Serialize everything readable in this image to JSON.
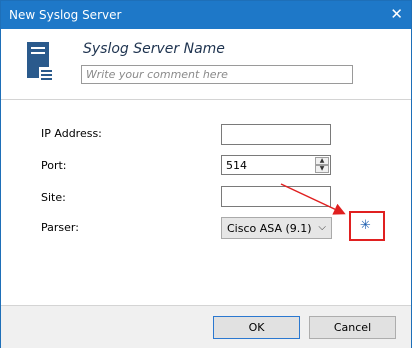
{
  "window": {
    "title": "New Syslog Server",
    "close_glyph": "✕"
  },
  "header": {
    "name": "Syslog Server Name",
    "comment_placeholder": "Write your comment here",
    "icon": "server-icon"
  },
  "form": {
    "ip_label": "IP Address:",
    "ip_value": "",
    "port_label": "Port:",
    "port_value": "514",
    "site_label": "Site:",
    "site_value": "",
    "parser_label": "Parser:",
    "parser_value": "Cisco ASA (9.1)",
    "parser_action_glyph": "✳",
    "highlight_color": "#e02020"
  },
  "footer": {
    "ok_label": "OK",
    "cancel_label": "Cancel"
  },
  "colors": {
    "titlebar": "#1e78c8",
    "accent": "#1e5fb0"
  }
}
